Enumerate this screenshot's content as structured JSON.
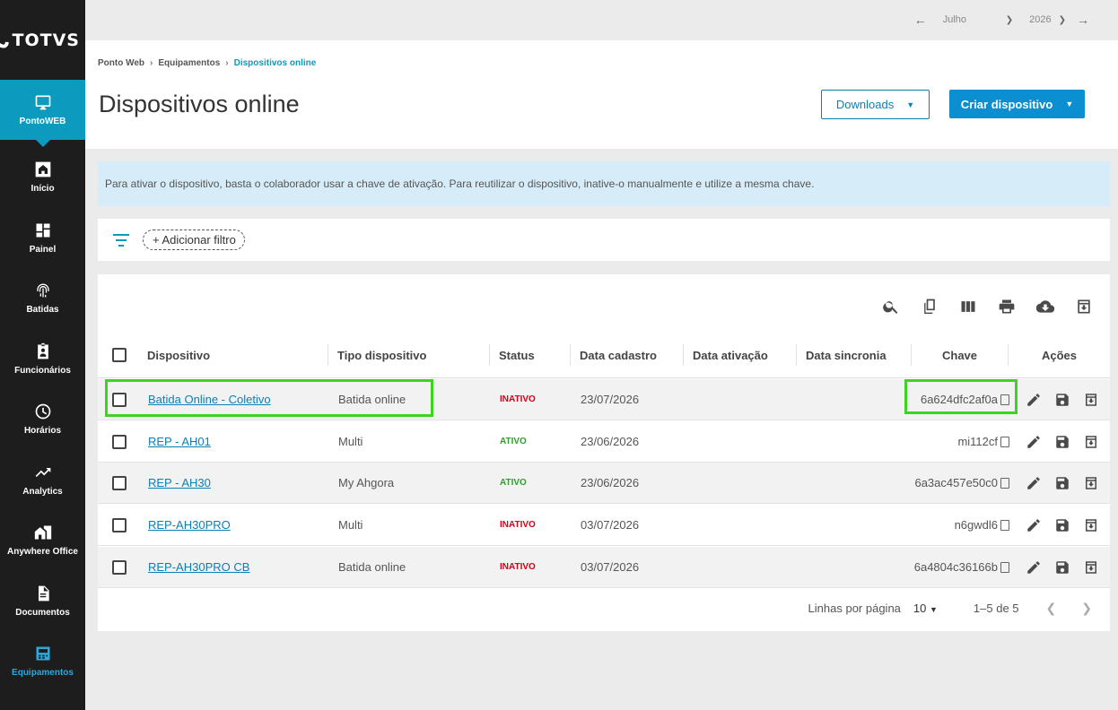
{
  "app": {
    "logo": "TOTVS",
    "module": "PontoWEB"
  },
  "sidebar": {
    "items": [
      {
        "label": "Início",
        "icon": "home-icon"
      },
      {
        "label": "Painel",
        "icon": "dashboard-icon"
      },
      {
        "label": "Batidas",
        "icon": "fingerprint-icon"
      },
      {
        "label": "Funcionários",
        "icon": "badge-icon"
      },
      {
        "label": "Horários",
        "icon": "clock-icon"
      },
      {
        "label": "Analytics",
        "icon": "trending-icon"
      },
      {
        "label": "Anywhere Office",
        "icon": "home-work-icon"
      },
      {
        "label": "Documentos",
        "icon": "document-icon"
      },
      {
        "label": "Equipamentos",
        "icon": "equipment-icon"
      }
    ]
  },
  "topbar": {
    "month": "Julho",
    "year": "2026"
  },
  "breadcrumb": {
    "item1": "Ponto Web",
    "item2": "Equipamentos",
    "current": "Dispositivos online"
  },
  "page": {
    "title": "Dispositivos online"
  },
  "actions": {
    "downloads": "Downloads",
    "criar": "Criar dispositivo"
  },
  "banner": {
    "text": "Para ativar o dispositivo, basta o colaborador usar a chave de ativação. Para reutilizar o dispositivo, inative-o manualmente e utilize a mesma chave."
  },
  "filter": {
    "add_label": "+ Adicionar filtro"
  },
  "table": {
    "columns": {
      "dispositivo": "Dispositivo",
      "tipo": "Tipo dispositivo",
      "status": "Status",
      "cadastro": "Data cadastro",
      "ativacao": "Data ativação",
      "sincronia": "Data sincronia",
      "chave": "Chave",
      "acoes": "Ações"
    },
    "rows": [
      {
        "dispositivo": "Batida Online - Coletivo",
        "tipo": "Batida online",
        "status": "INATIVO",
        "cadastro": "23/07/2026",
        "ativacao": "",
        "sincronia": "",
        "chave": "6a624dfc2af0a"
      },
      {
        "dispositivo": "REP - AH01",
        "tipo": "Multi",
        "status": "ATIVO",
        "cadastro": "23/06/2026",
        "ativacao": "",
        "sincronia": "",
        "chave": "mi112cf"
      },
      {
        "dispositivo": "REP - AH30",
        "tipo": "My Ahgora",
        "status": "ATIVO",
        "cadastro": "23/06/2026",
        "ativacao": "",
        "sincronia": "",
        "chave": "6a3ac457e50c0"
      },
      {
        "dispositivo": "REP-AH30PRO",
        "tipo": "Multi",
        "status": "INATIVO",
        "cadastro": "03/07/2026",
        "ativacao": "",
        "sincronia": "",
        "chave": "n6gwdl6"
      },
      {
        "dispositivo": "REP-AH30PRO CB",
        "tipo": "Batida online",
        "status": "INATIVO",
        "cadastro": "03/07/2026",
        "ativacao": "",
        "sincronia": "",
        "chave": "6a4804c36166b"
      }
    ]
  },
  "pagination": {
    "rows_label": "Linhas por página",
    "rows_value": "10",
    "range": "1–5 de 5"
  },
  "colors": {
    "accent": "#0c9abe",
    "highlight": "#3ed321",
    "inactive": "#d0021b",
    "active": "#2e9e2e"
  }
}
